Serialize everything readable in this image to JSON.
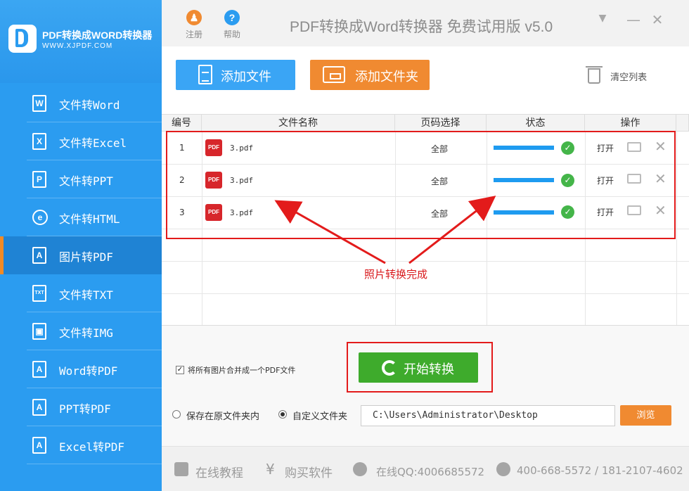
{
  "logo": {
    "title": "PDF转换成WORD转换器",
    "url": "WWW.XJPDF.COM"
  },
  "sidebar": {
    "items": [
      {
        "label": "文件转Word",
        "icon": "W"
      },
      {
        "label": "文件转Excel",
        "icon": "X"
      },
      {
        "label": "文件转PPT",
        "icon": "P"
      },
      {
        "label": "文件转HTML",
        "icon": "e"
      },
      {
        "label": "图片转PDF",
        "icon": "A"
      },
      {
        "label": "文件转TXT",
        "icon": "TXT"
      },
      {
        "label": "文件转IMG",
        "icon": "▣"
      },
      {
        "label": "Word转PDF",
        "icon": "A"
      },
      {
        "label": "PPT转PDF",
        "icon": "A"
      },
      {
        "label": "Excel转PDF",
        "icon": "A"
      }
    ]
  },
  "titlebar": {
    "register_label": "注册",
    "help_label": "帮助",
    "help_glyph": "?",
    "register_glyph": "♟",
    "app_title": "PDF转换成Word转换器 免费试用版 v5.0",
    "min_glyph": "▼",
    "minimize_glyph": "—",
    "close_glyph": "✕"
  },
  "toolbar": {
    "add_file": "添加文件",
    "add_folder": "添加文件夹",
    "clear_list": "清空列表"
  },
  "table": {
    "headers": [
      "编号",
      "文件名称",
      "页码选择",
      "状态",
      "操作"
    ],
    "rows": [
      {
        "num": "1",
        "file": "3.pdf",
        "pages": "全部",
        "progress": 100,
        "action": "打开"
      },
      {
        "num": "2",
        "file": "3.pdf",
        "pages": "全部",
        "progress": 100,
        "action": "打开"
      },
      {
        "num": "3",
        "file": "3.pdf",
        "pages": "全部",
        "progress": 100,
        "action": "打开"
      }
    ],
    "pdf_badge": "PDF",
    "check_glyph": "✓",
    "delete_glyph": "✕"
  },
  "annotation": "照片转换完成",
  "options": {
    "merge_label": "将所有图片合并成一个PDF文件",
    "merge_checked": true,
    "save_original_label": "保存在原文件夹内",
    "custom_folder_label": "自定义文件夹",
    "output_path": "C:\\Users\\Administrator\\Desktop",
    "browse_label": "浏览",
    "start_label": "开始转换",
    "check_glyph": "✓"
  },
  "footer": {
    "tutorial": "在线教程",
    "buy": "购买软件",
    "qq": "在线QQ:4006685572",
    "phone": "400-668-5572 / 181-2107-4602",
    "buy_glyph": "¥"
  },
  "colors": {
    "sidebar": "#2b9cf0",
    "add_file": "#3aa5f5",
    "add_folder": "#f08a31",
    "start": "#3eab2c",
    "annotation": "#e31b1b"
  }
}
